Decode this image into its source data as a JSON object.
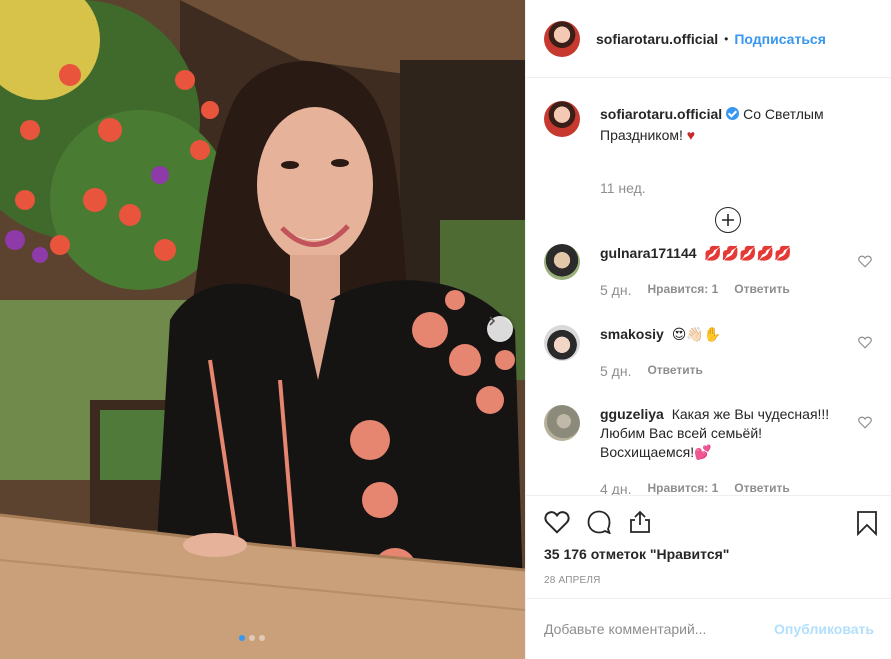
{
  "post": {
    "username": "sofiarotaru.official",
    "separator": "•",
    "follow_label": "Подписаться",
    "caption_text": "Со Светлым Праздником!",
    "caption_heart": "♥",
    "caption_time": "11 нед."
  },
  "comments": [
    {
      "username": "gulnara171144",
      "text": "💋💋💋💋💋",
      "time": "5 дн.",
      "likes": "Нравится: 1",
      "reply": "Ответить"
    },
    {
      "username": "smakosiy",
      "text": "😍👋🏻✋",
      "time": "5 дн.",
      "likes": "",
      "reply": "Ответить"
    },
    {
      "username": "gguzeliya",
      "text": "Какая же Вы чудесная!!! Любим Вас всей семьёй! Восхищаемся!💕",
      "time": "4 дн.",
      "likes": "Нравится: 1",
      "reply": "Ответить"
    }
  ],
  "actions": {
    "likes_text": "35 176 отметок \"Нравится\"",
    "date": "28 АПРЕЛЯ"
  },
  "add_comment": {
    "placeholder": "Добавьте комментарий...",
    "post_label": "Опубликовать"
  },
  "carousel": {
    "current": 1,
    "total": 3
  },
  "colors": {
    "accent": "#3897f0",
    "text": "#262626",
    "muted": "#8e8e8e",
    "border": "#efefef"
  }
}
